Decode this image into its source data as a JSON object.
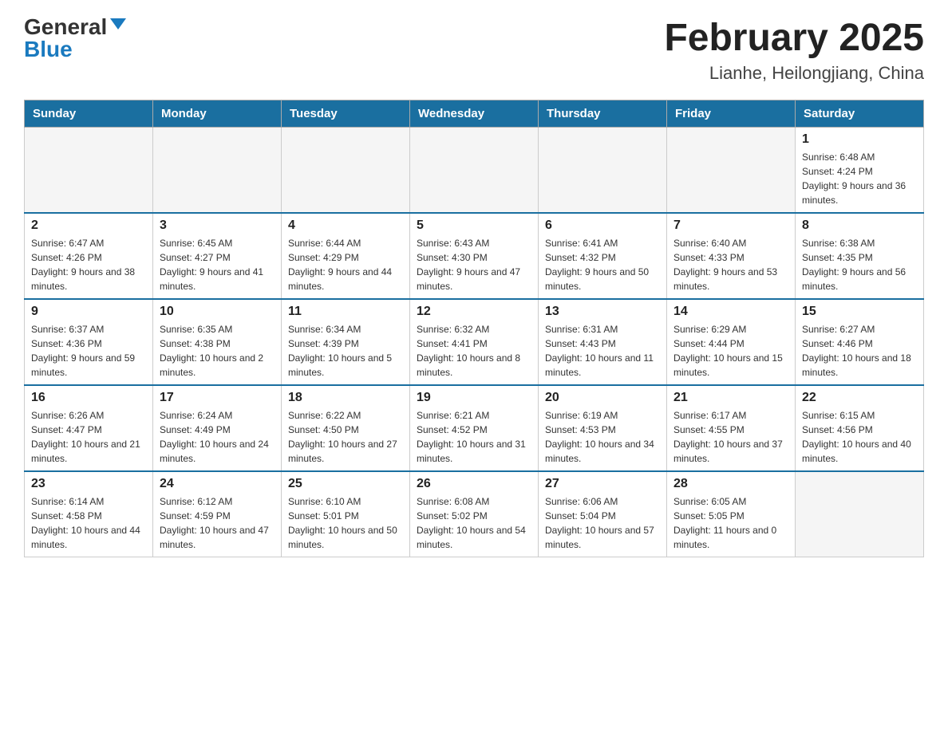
{
  "header": {
    "logo_general": "General",
    "logo_blue": "Blue",
    "title": "February 2025",
    "subtitle": "Lianhe, Heilongjiang, China"
  },
  "days_of_week": [
    "Sunday",
    "Monday",
    "Tuesday",
    "Wednesday",
    "Thursday",
    "Friday",
    "Saturday"
  ],
  "weeks": [
    {
      "days": [
        {
          "num": "",
          "info": ""
        },
        {
          "num": "",
          "info": ""
        },
        {
          "num": "",
          "info": ""
        },
        {
          "num": "",
          "info": ""
        },
        {
          "num": "",
          "info": ""
        },
        {
          "num": "",
          "info": ""
        },
        {
          "num": "1",
          "info": "Sunrise: 6:48 AM\nSunset: 4:24 PM\nDaylight: 9 hours and 36 minutes."
        }
      ]
    },
    {
      "days": [
        {
          "num": "2",
          "info": "Sunrise: 6:47 AM\nSunset: 4:26 PM\nDaylight: 9 hours and 38 minutes."
        },
        {
          "num": "3",
          "info": "Sunrise: 6:45 AM\nSunset: 4:27 PM\nDaylight: 9 hours and 41 minutes."
        },
        {
          "num": "4",
          "info": "Sunrise: 6:44 AM\nSunset: 4:29 PM\nDaylight: 9 hours and 44 minutes."
        },
        {
          "num": "5",
          "info": "Sunrise: 6:43 AM\nSunset: 4:30 PM\nDaylight: 9 hours and 47 minutes."
        },
        {
          "num": "6",
          "info": "Sunrise: 6:41 AM\nSunset: 4:32 PM\nDaylight: 9 hours and 50 minutes."
        },
        {
          "num": "7",
          "info": "Sunrise: 6:40 AM\nSunset: 4:33 PM\nDaylight: 9 hours and 53 minutes."
        },
        {
          "num": "8",
          "info": "Sunrise: 6:38 AM\nSunset: 4:35 PM\nDaylight: 9 hours and 56 minutes."
        }
      ]
    },
    {
      "days": [
        {
          "num": "9",
          "info": "Sunrise: 6:37 AM\nSunset: 4:36 PM\nDaylight: 9 hours and 59 minutes."
        },
        {
          "num": "10",
          "info": "Sunrise: 6:35 AM\nSunset: 4:38 PM\nDaylight: 10 hours and 2 minutes."
        },
        {
          "num": "11",
          "info": "Sunrise: 6:34 AM\nSunset: 4:39 PM\nDaylight: 10 hours and 5 minutes."
        },
        {
          "num": "12",
          "info": "Sunrise: 6:32 AM\nSunset: 4:41 PM\nDaylight: 10 hours and 8 minutes."
        },
        {
          "num": "13",
          "info": "Sunrise: 6:31 AM\nSunset: 4:43 PM\nDaylight: 10 hours and 11 minutes."
        },
        {
          "num": "14",
          "info": "Sunrise: 6:29 AM\nSunset: 4:44 PM\nDaylight: 10 hours and 15 minutes."
        },
        {
          "num": "15",
          "info": "Sunrise: 6:27 AM\nSunset: 4:46 PM\nDaylight: 10 hours and 18 minutes."
        }
      ]
    },
    {
      "days": [
        {
          "num": "16",
          "info": "Sunrise: 6:26 AM\nSunset: 4:47 PM\nDaylight: 10 hours and 21 minutes."
        },
        {
          "num": "17",
          "info": "Sunrise: 6:24 AM\nSunset: 4:49 PM\nDaylight: 10 hours and 24 minutes."
        },
        {
          "num": "18",
          "info": "Sunrise: 6:22 AM\nSunset: 4:50 PM\nDaylight: 10 hours and 27 minutes."
        },
        {
          "num": "19",
          "info": "Sunrise: 6:21 AM\nSunset: 4:52 PM\nDaylight: 10 hours and 31 minutes."
        },
        {
          "num": "20",
          "info": "Sunrise: 6:19 AM\nSunset: 4:53 PM\nDaylight: 10 hours and 34 minutes."
        },
        {
          "num": "21",
          "info": "Sunrise: 6:17 AM\nSunset: 4:55 PM\nDaylight: 10 hours and 37 minutes."
        },
        {
          "num": "22",
          "info": "Sunrise: 6:15 AM\nSunset: 4:56 PM\nDaylight: 10 hours and 40 minutes."
        }
      ]
    },
    {
      "days": [
        {
          "num": "23",
          "info": "Sunrise: 6:14 AM\nSunset: 4:58 PM\nDaylight: 10 hours and 44 minutes."
        },
        {
          "num": "24",
          "info": "Sunrise: 6:12 AM\nSunset: 4:59 PM\nDaylight: 10 hours and 47 minutes."
        },
        {
          "num": "25",
          "info": "Sunrise: 6:10 AM\nSunset: 5:01 PM\nDaylight: 10 hours and 50 minutes."
        },
        {
          "num": "26",
          "info": "Sunrise: 6:08 AM\nSunset: 5:02 PM\nDaylight: 10 hours and 54 minutes."
        },
        {
          "num": "27",
          "info": "Sunrise: 6:06 AM\nSunset: 5:04 PM\nDaylight: 10 hours and 57 minutes."
        },
        {
          "num": "28",
          "info": "Sunrise: 6:05 AM\nSunset: 5:05 PM\nDaylight: 11 hours and 0 minutes."
        },
        {
          "num": "",
          "info": ""
        }
      ]
    }
  ]
}
